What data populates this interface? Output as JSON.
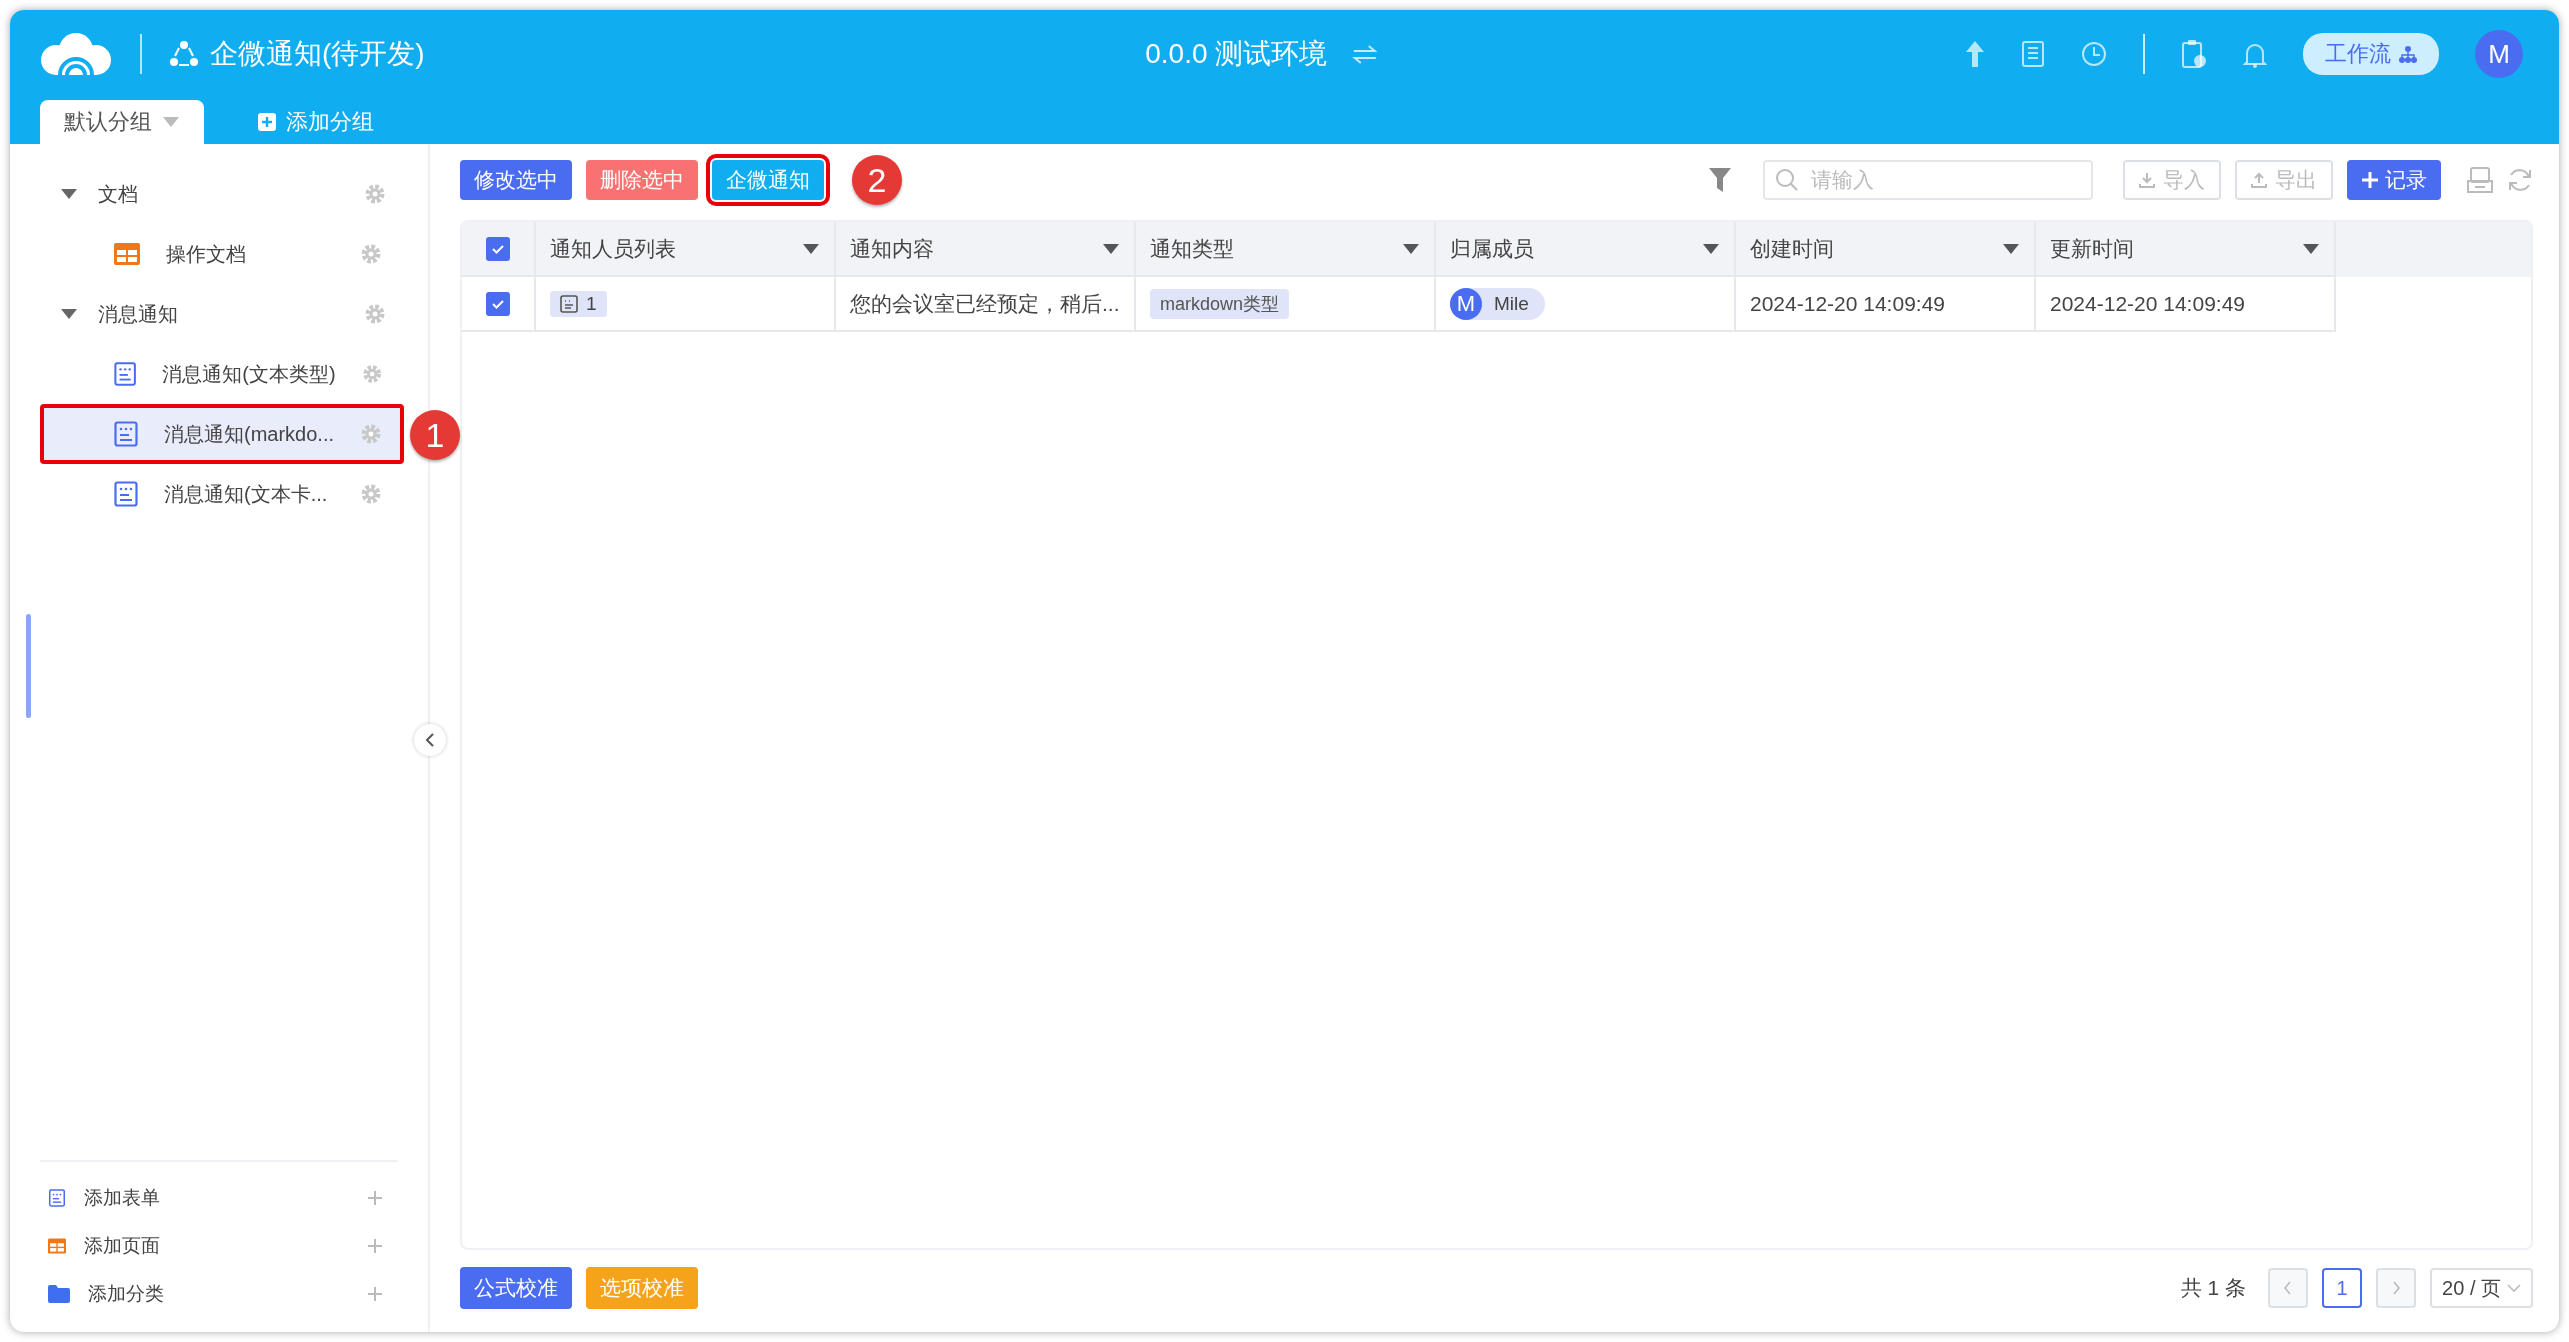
{
  "header": {
    "title": "企微通知(待开发)",
    "environment": "0.0.0 测试环境",
    "workflow_button": "工作流",
    "avatar": "M"
  },
  "group_tabs": [
    {
      "label": "默认分组",
      "kind": "tab",
      "selected": true
    },
    {
      "label": "添加分组",
      "kind": "add",
      "selected": false
    }
  ],
  "sidebar": {
    "tree": [
      {
        "label": "文档",
        "expanded": true,
        "children": [
          {
            "label": "操作文档",
            "kind": "page",
            "selected": false
          }
        ]
      },
      {
        "label": "消息通知",
        "expanded": true,
        "children": [
          {
            "label": "消息通知(文本类型)",
            "kind": "form",
            "selected": false
          },
          {
            "label": "消息通知(markdo...",
            "kind": "form",
            "selected": true,
            "annotation": "1"
          },
          {
            "label": "消息通知(文本卡...",
            "kind": "form",
            "selected": false
          }
        ]
      }
    ],
    "actions": [
      {
        "label": "添加表单",
        "kind": "form"
      },
      {
        "label": "添加页面",
        "kind": "page"
      },
      {
        "label": "添加分类",
        "kind": "folder"
      }
    ]
  },
  "toolbar": {
    "buttons": [
      {
        "label": "修改选中",
        "kind": "primary"
      },
      {
        "label": "删除选中",
        "kind": "danger"
      },
      {
        "label": "企微通知",
        "kind": "info",
        "annotation": "2"
      }
    ],
    "search": {
      "placeholder": "请输入"
    },
    "import_button": "导入",
    "export_button": "导出",
    "add_button": "记录"
  },
  "table": {
    "all_checked": true,
    "columns": [
      "通知人员列表",
      "通知内容",
      "通知类型",
      "归属成员",
      "创建时间",
      "更新时间"
    ],
    "rows": [
      {
        "checked": true,
        "cells": [
          {
            "kind": "count",
            "text": "1"
          },
          {
            "kind": "text",
            "text": "您的会议室已经预定，稍后..."
          },
          {
            "kind": "tag",
            "text": "markdown类型"
          },
          {
            "kind": "member",
            "avatar": "M",
            "text": "Mile"
          },
          {
            "kind": "text",
            "text": "2024-12-20 14:09:49"
          },
          {
            "kind": "text",
            "text": "2024-12-20 14:09:49"
          }
        ]
      }
    ]
  },
  "footer": {
    "buttons": [
      {
        "label": "公式校准",
        "kind": "primary"
      },
      {
        "label": "选项校准",
        "kind": "warning"
      }
    ],
    "total": "共 1 条",
    "pages": [
      {
        "label": "1",
        "selected": true
      }
    ],
    "page_size": "20 / 页"
  }
}
